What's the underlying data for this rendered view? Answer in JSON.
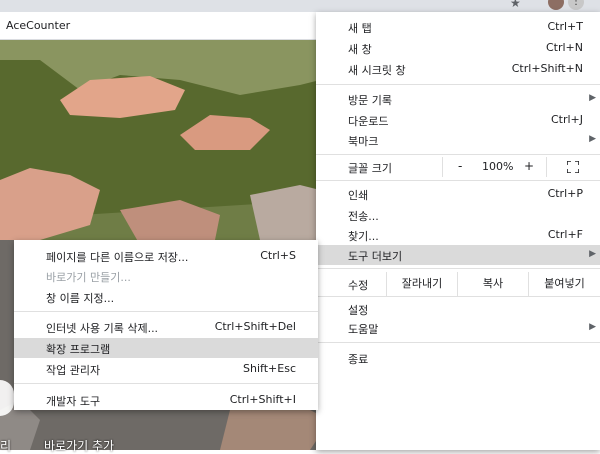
{
  "browser": {
    "bookmark": "AceCounter",
    "bottom_shortcut_label": "바로가기 추가",
    "bottom_left_fragment": "리"
  },
  "main_menu": {
    "new_tab": {
      "label": "새 탭",
      "shortcut": "Ctrl+T"
    },
    "new_window": {
      "label": "새 창",
      "shortcut": "Ctrl+N"
    },
    "new_incognito": {
      "label": "새 시크릿 창",
      "shortcut": "Ctrl+Shift+N"
    },
    "history": {
      "label": "방문 기록"
    },
    "downloads": {
      "label": "다운로드",
      "shortcut": "Ctrl+J"
    },
    "bookmarks": {
      "label": "북마크"
    },
    "zoom": {
      "label": "글꼴 크기",
      "minus": "-",
      "value": "100%",
      "plus": "+"
    },
    "print": {
      "label": "인쇄",
      "shortcut": "Ctrl+P"
    },
    "cast": {
      "label": "전송..."
    },
    "find": {
      "label": "찾기...",
      "shortcut": "Ctrl+F"
    },
    "more_tools": {
      "label": "도구 더보기"
    },
    "edit": {
      "label": "수정",
      "cut": "잘라내기",
      "copy": "복사",
      "paste": "붙여넣기"
    },
    "settings": {
      "label": "설정"
    },
    "help": {
      "label": "도움말"
    },
    "exit": {
      "label": "종료"
    }
  },
  "sub_menu": {
    "save_page": {
      "label": "페이지를 다른 이름으로 저장...",
      "shortcut": "Ctrl+S"
    },
    "create_shortcut": {
      "label": "바로가기 만들기..."
    },
    "name_window": {
      "label": "창 이름 지정..."
    },
    "clear_data": {
      "label": "인터넷 사용 기록 삭제...",
      "shortcut": "Ctrl+Shift+Del"
    },
    "extensions": {
      "label": "확장 프로그램"
    },
    "task_manager": {
      "label": "작업 관리자",
      "shortcut": "Shift+Esc"
    },
    "dev_tools": {
      "label": "개발자 도구",
      "shortcut": "Ctrl+Shift+I"
    }
  }
}
